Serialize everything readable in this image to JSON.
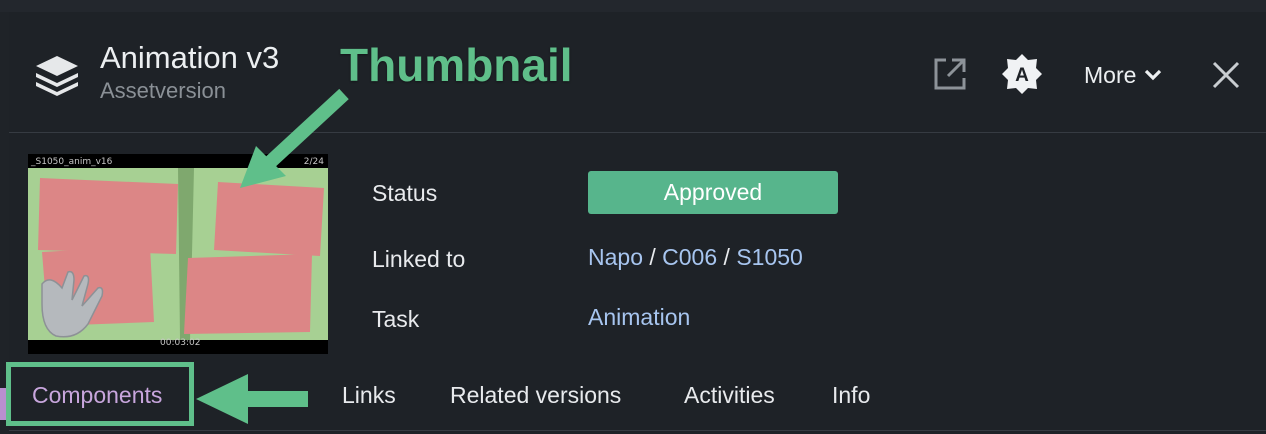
{
  "header": {
    "title": "Animation v3",
    "subtitle": "Assetversion",
    "more_label": "More",
    "badge_letter": "A",
    "icons": [
      "layers-icon",
      "open-external-icon",
      "approver-badge-icon",
      "chevron-down-icon",
      "close-icon"
    ]
  },
  "annotation": {
    "label": "Thumbnail",
    "color": "#5fbf8a"
  },
  "thumbnail": {
    "caption_left": "_S1050_anim_v16",
    "caption_right": "2/24",
    "timecode": "00:03:02"
  },
  "details": {
    "status_label": "Status",
    "status_value": "Approved",
    "status_color": "#57b58c",
    "linked_label": "Linked to",
    "linked_path": [
      "Napo",
      "C006",
      "S1050"
    ],
    "path_separator": "/",
    "task_label": "Task",
    "task_value": "Animation",
    "link_color": "#a7c5ef"
  },
  "tabs": [
    {
      "label": "Components",
      "active": true
    },
    {
      "label": "Links",
      "active": false
    },
    {
      "label": "Related versions",
      "active": false
    },
    {
      "label": "Activities",
      "active": false
    },
    {
      "label": "Info",
      "active": false
    }
  ],
  "colors": {
    "background": "#1e2227",
    "active_tab": "#c8a6dd",
    "annotation_green": "#5fbf8a"
  }
}
